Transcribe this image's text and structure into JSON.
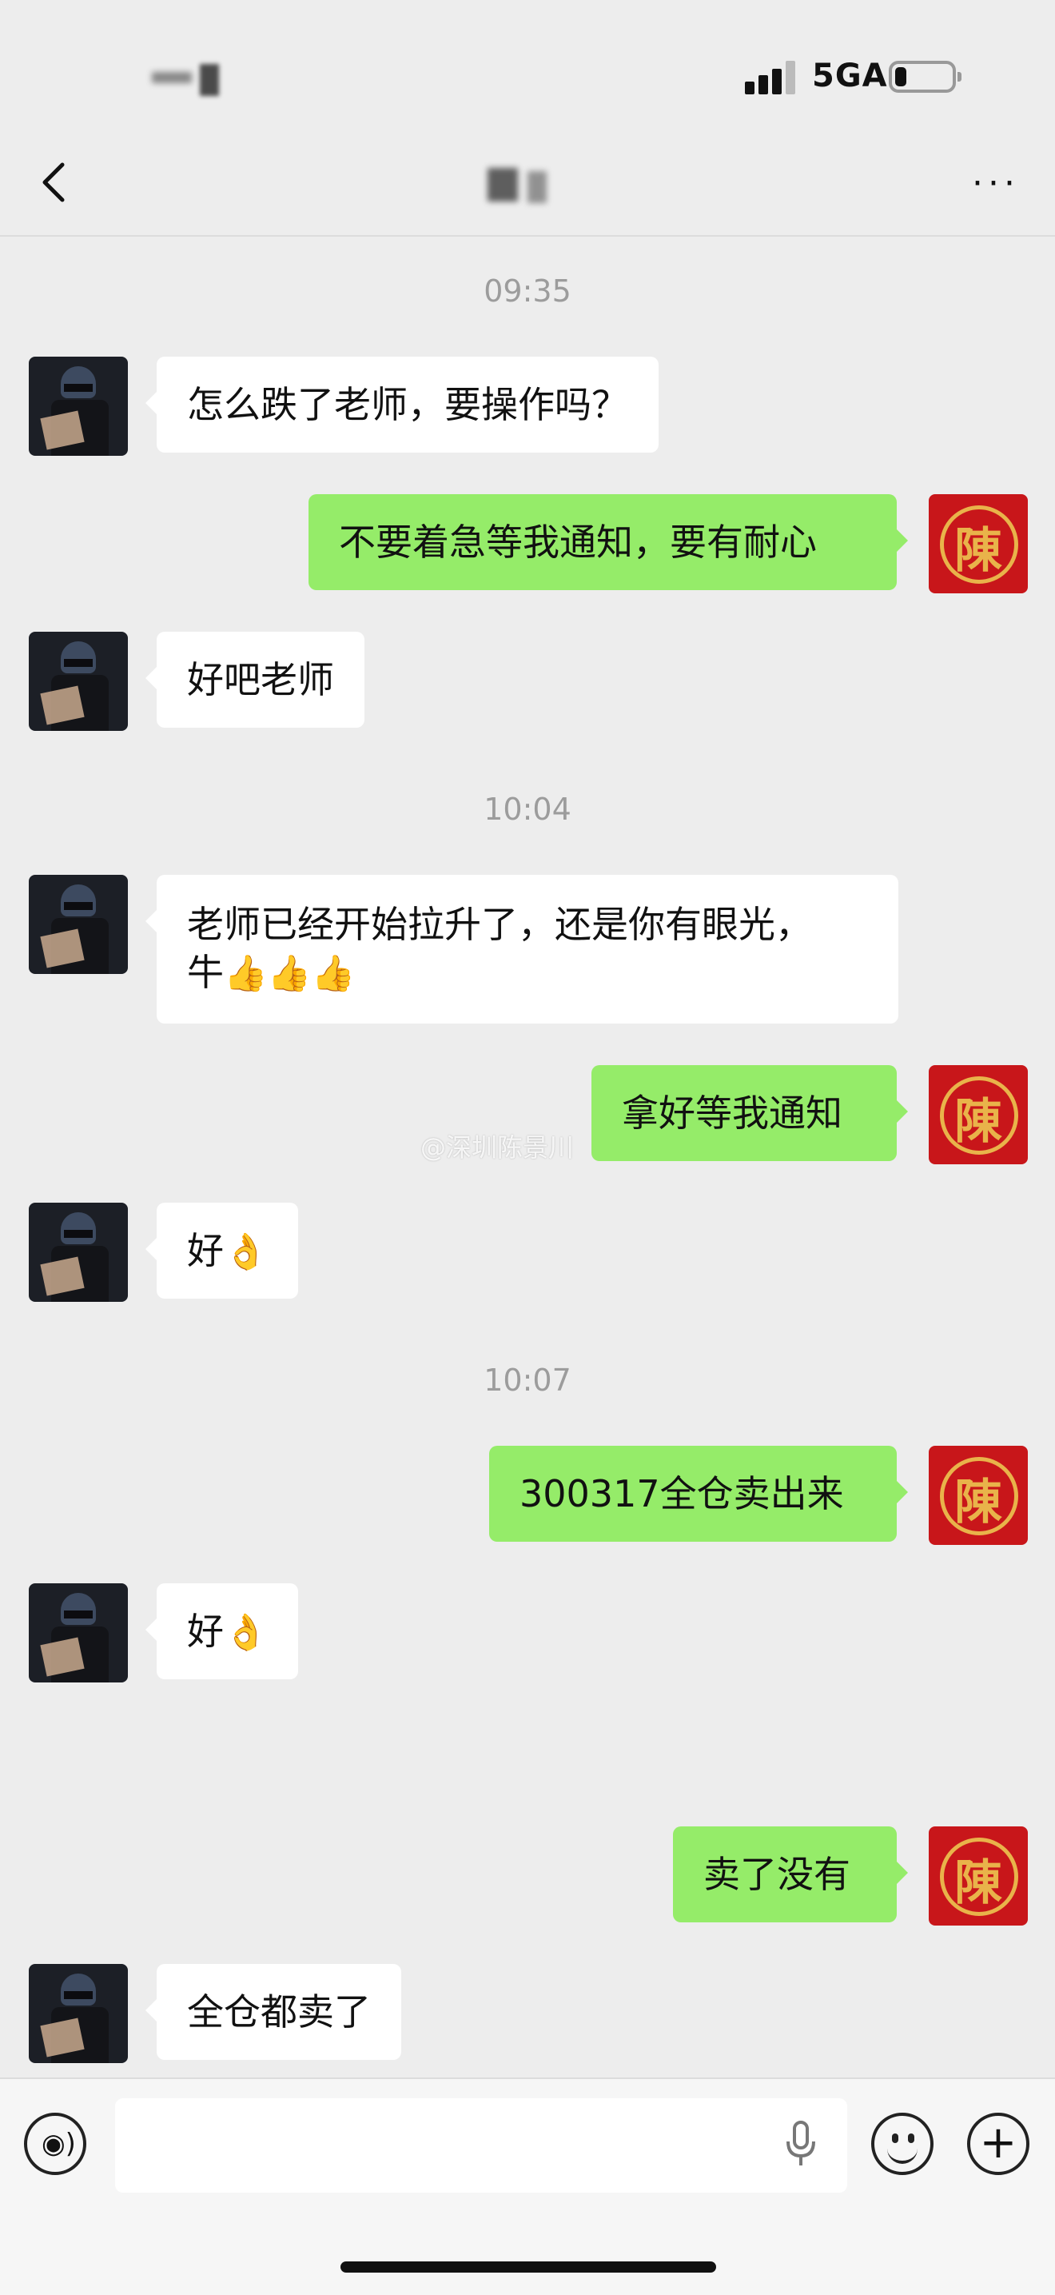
{
  "status_bar": {
    "network": "5GA",
    "signal_icon": "signal-bars-icon",
    "battery_icon": "battery-icon"
  },
  "nav": {
    "back_icon": "chevron-left-icon",
    "more_icon": "more-icon",
    "more_label": "···"
  },
  "timestamps": [
    "09:35",
    "10:04",
    "10:07"
  ],
  "messages": [
    {
      "side": "in",
      "text": "怎么跌了老师，要操作吗？"
    },
    {
      "side": "out",
      "text": "不要着急等我通知，要有耐心"
    },
    {
      "side": "in",
      "text": "好吧老师"
    },
    {
      "side": "in",
      "text": "老师已经开始拉升了，还是你有眼光，",
      "line2": "牛",
      "emoji": "👍👍👍"
    },
    {
      "side": "out",
      "text": "拿好等我通知"
    },
    {
      "side": "in",
      "text": "好",
      "emoji": "👌"
    },
    {
      "side": "out",
      "text": "300317全仓卖出来"
    },
    {
      "side": "in",
      "text": "好",
      "emoji": "👌"
    },
    {
      "side": "out",
      "text": "卖了没有"
    },
    {
      "side": "in",
      "text": "全仓都卖了"
    }
  ],
  "avatars": {
    "right_char": "陳"
  },
  "watermark": "@深圳陈景川",
  "input_bar": {
    "voice_icon": "voice-icon",
    "mic_icon": "microphone-icon",
    "emoji_icon": "emoji-icon",
    "plus_icon": "plus-icon",
    "plus_label": "+",
    "voice_label": "◉)",
    "input_value": ""
  },
  "colors": {
    "background": "#ededed",
    "outgoing_bubble": "#95ec69",
    "incoming_bubble": "#ffffff",
    "timestamp": "#9c9c9c"
  }
}
